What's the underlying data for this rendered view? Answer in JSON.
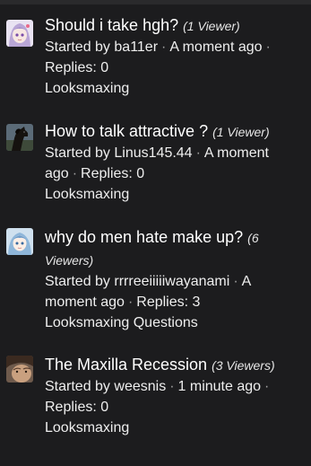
{
  "threads": [
    {
      "title": "Should i take hgh?",
      "viewers": "(1 Viewer)",
      "started_by_prefix": "Started by",
      "author": "ba11er",
      "time": "A moment ago",
      "replies": "Replies: 0",
      "forum": "Looksmaxing",
      "avatar_icon": "anime-girl-avatar"
    },
    {
      "title": "How to talk attractive ?",
      "viewers": "(1 Viewer)",
      "started_by_prefix": "Started by",
      "author": "Linus145.44",
      "time": "A moment ago",
      "replies": "Replies: 0",
      "forum": "Looksmaxing",
      "avatar_icon": "horse-avatar"
    },
    {
      "title": "why do men hate make up?",
      "viewers": "(6 Viewers)",
      "started_by_prefix": "Started by",
      "author": "rrrreeiiiiiwayanami",
      "time": "A moment ago",
      "replies": "Replies: 3",
      "forum": "Looksmaxing Questions",
      "avatar_icon": "anime-girl-blue-avatar"
    },
    {
      "title": "The Maxilla Recession",
      "viewers": "(3 Viewers)",
      "started_by_prefix": "Started by",
      "author": "weesnis",
      "time": "1 minute ago",
      "replies": "Replies: 0",
      "forum": "Looksmaxing",
      "avatar_icon": "face-avatar"
    }
  ],
  "separator": "·"
}
